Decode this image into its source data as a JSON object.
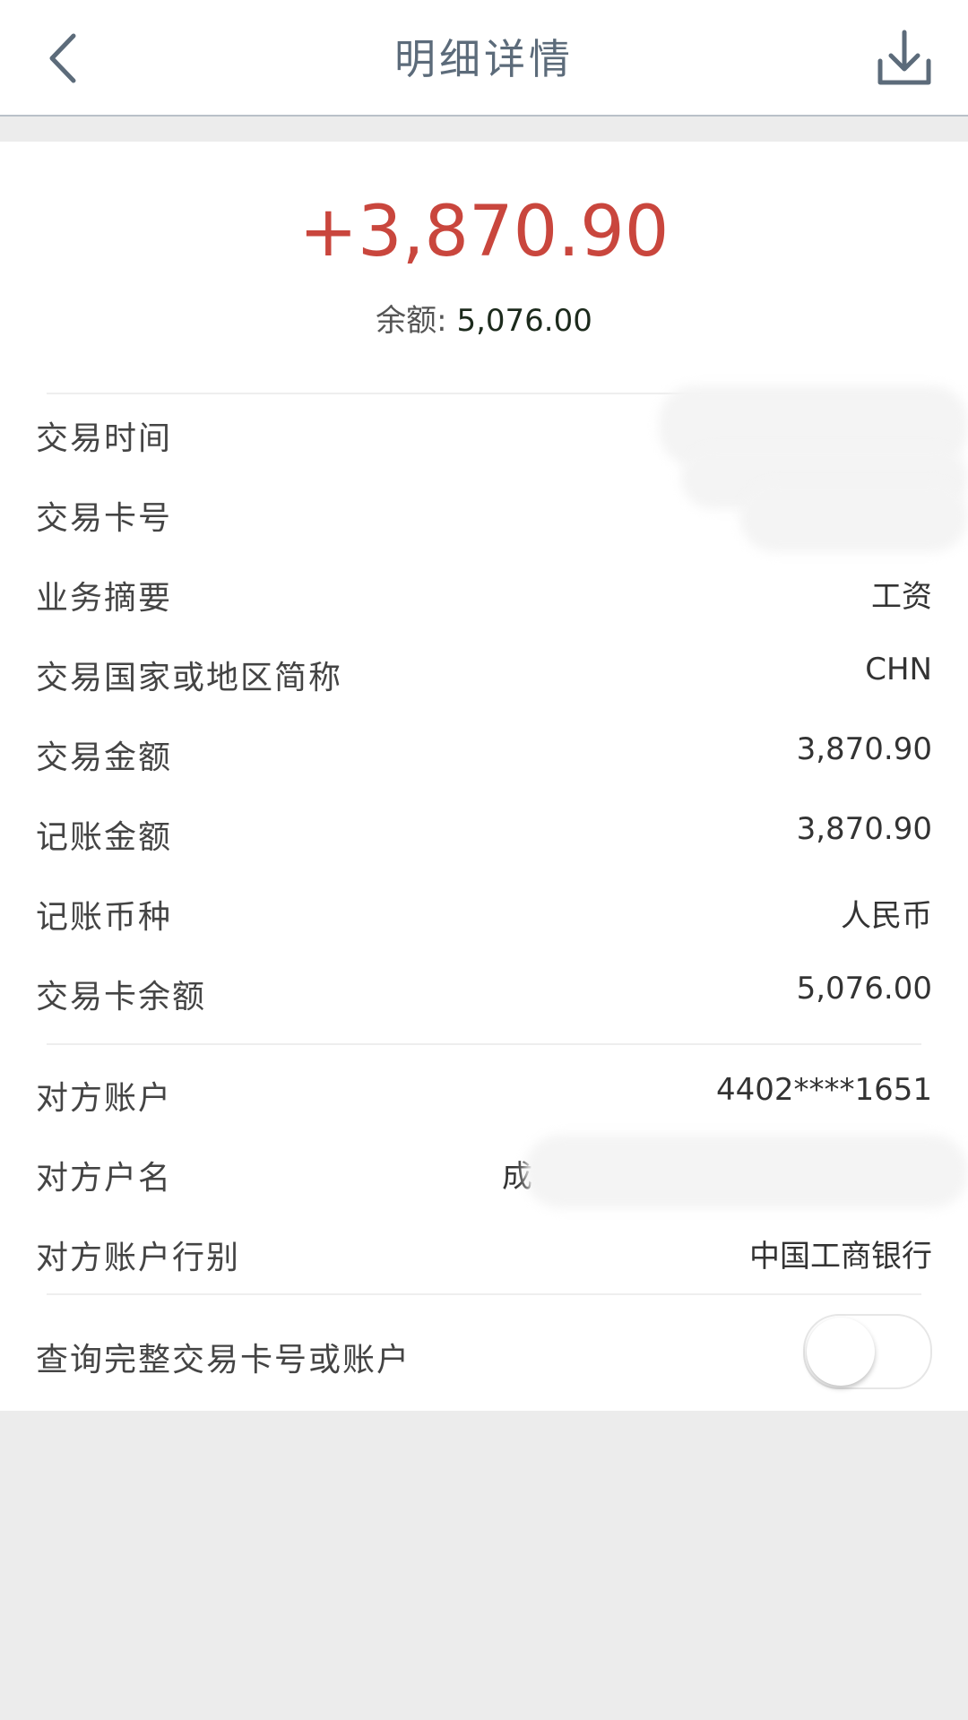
{
  "header": {
    "title": "明细详情",
    "back_icon": "chevron-left-icon",
    "download_icon": "download-icon"
  },
  "summary": {
    "amount": "+3,870.90",
    "balance_label": "余额:",
    "balance_value": "5,076.00",
    "amount_color": "#c9463d"
  },
  "details": [
    {
      "label": "交易时间",
      "value": ""
    },
    {
      "label": "交易卡号",
      "value": ""
    },
    {
      "label": "业务摘要",
      "value": "工资"
    },
    {
      "label": "交易国家或地区简称",
      "value": "CHN"
    },
    {
      "label": "交易金额",
      "value": "3,870.90"
    },
    {
      "label": "记账金额",
      "value": "3,870.90"
    },
    {
      "label": "记账币种",
      "value": "人民币"
    },
    {
      "label": "交易卡余额",
      "value": "5,076.00"
    }
  ],
  "counterparty": [
    {
      "label": "对方账户",
      "value": "4402****1651"
    },
    {
      "label": "对方户名",
      "value": "成"
    },
    {
      "label": "对方账户行别",
      "value": "中国工商银行"
    }
  ],
  "toggle": {
    "label": "查询完整交易卡号或账户",
    "state": "off"
  }
}
